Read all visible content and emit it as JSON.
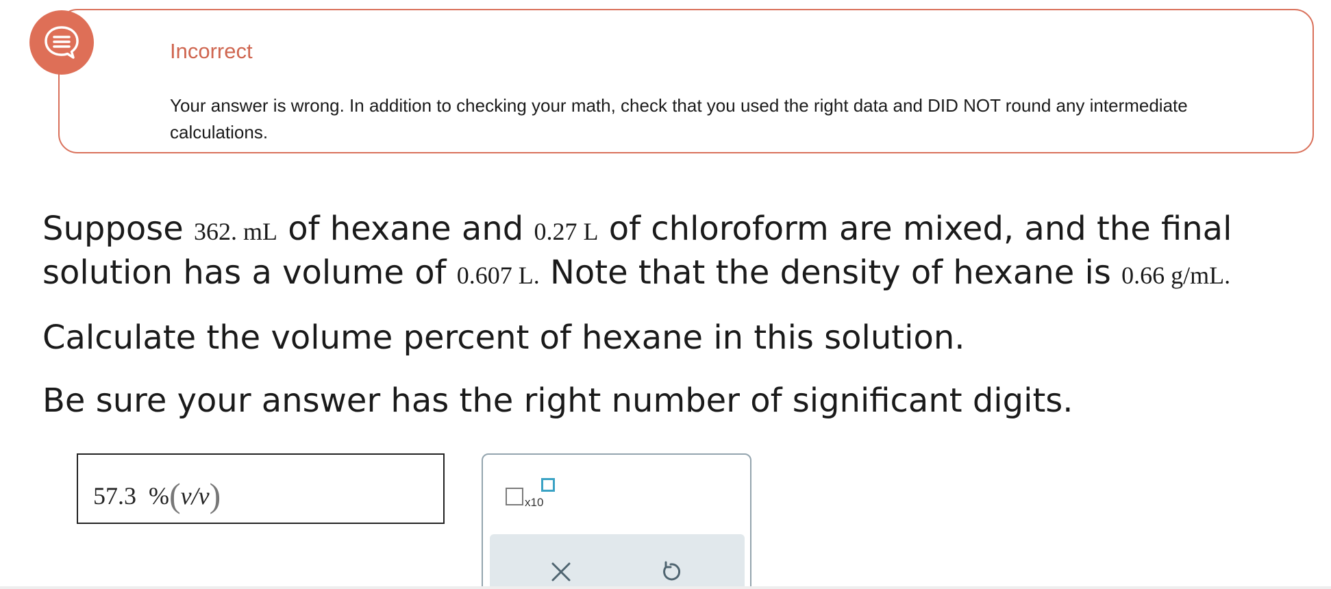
{
  "feedback": {
    "icon": "chat-bubble-icon",
    "title": "Incorrect",
    "message": "Your answer is wrong. In addition to checking your math, check that you used the right data and DID NOT round any intermediate calculations.",
    "accent_color": "#de6f57"
  },
  "question": {
    "line1": {
      "t1": "Suppose ",
      "v1": "362. mL",
      "t2": " of hexane and ",
      "v2": "0.27 L",
      "t3": " of chloroform are mixed, and the final"
    },
    "line2": {
      "t1": "solution has a volume of ",
      "v1": "0.607 L.",
      "t2": " Note that the density of hexane is ",
      "v2": "0.66 g/mL."
    },
    "prompt": "Calculate the volume percent of hexane in this solution.",
    "sigfig_note": "Be sure your answer has the right number of significant digits."
  },
  "answer": {
    "value": "57.3",
    "unit_percent": "%",
    "unit_paren_open": "(",
    "unit_ratio": "v/v",
    "unit_paren_close": ")"
  },
  "toolbox": {
    "sci_notation_label": "x10",
    "clear_icon": "x-icon",
    "undo_icon": "undo-icon",
    "exponent_box_color": "#3aa2c4"
  }
}
